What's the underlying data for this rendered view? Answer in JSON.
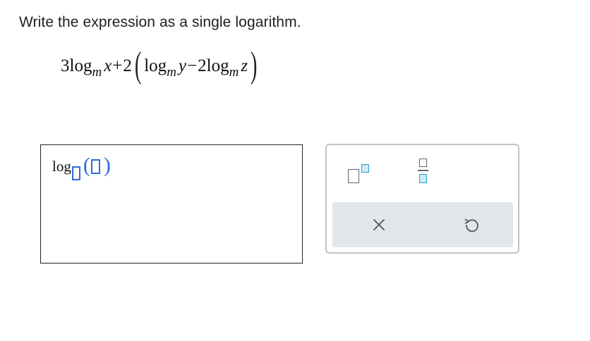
{
  "question": {
    "prompt": "Write the expression as a single logarithm.",
    "expression": {
      "coef1": "3",
      "log": "log",
      "base": "m",
      "var_x": "x",
      "plus": "+",
      "coef2": "2",
      "var_y": "y",
      "minus": "−",
      "coef3": "2",
      "var_z": "z"
    }
  },
  "answer": {
    "log_label": "log"
  },
  "toolbar": {
    "buttons": [
      "exponent-template-icon",
      "fraction-template-icon",
      "clear-icon",
      "undo-icon"
    ]
  },
  "colors": {
    "slot_blue": "#2b6be0",
    "toolbar_border": "#b9c4cc",
    "action_bar_bg": "#e1e6ea",
    "icon_gray": "#5a6770",
    "icon_teal": "#2aa0c8"
  }
}
